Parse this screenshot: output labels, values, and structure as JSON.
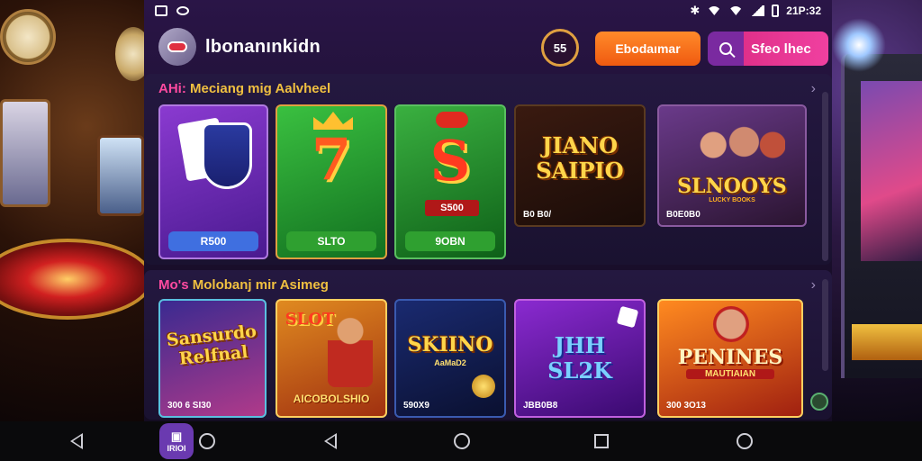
{
  "status_bar": {
    "time": "21P:32"
  },
  "header": {
    "username": "lbonanınkidn",
    "coin_label": "55",
    "deposit_label": "Ebodaımar",
    "search_label": "Sfeo lhec"
  },
  "sections": [
    {
      "title_accent": "AHi:",
      "title": "Meciang mig Aalvheel",
      "cards": [
        {
          "art": "cards",
          "pill": "R500",
          "pill_color": "#3f6fe0"
        },
        {
          "art": "7",
          "pill": "SLTO",
          "pill_color": "#2fa030"
        },
        {
          "art": "S",
          "label": "S500",
          "pill": "9OBN",
          "pill_color": "#2fa030"
        },
        {
          "art_title": "JIANO SAIPIO",
          "meta": "B0 B0/"
        },
        {
          "art_title": "SLNOOYS",
          "subtitle": "LUCKY BOOKS",
          "meta": "B0E0B0"
        }
      ]
    },
    {
      "title_accent": "Mo's",
      "title": "Molobanj mir Asimeg",
      "cards": [
        {
          "art_title": "Sansurdo Relfnal",
          "meta": "300 6 SI30"
        },
        {
          "art_title": "SLOT",
          "subtitle": "AICOBOLSHIO"
        },
        {
          "art_title": "SKIINO",
          "subtitle": "AaMaD2",
          "meta": "590X9"
        },
        {
          "art_title": "JHH SL2K",
          "meta": "JBB0B8"
        },
        {
          "art_title": "PENINES",
          "subtitle": "MAUTIAIAN",
          "meta": "300 3O13"
        }
      ]
    }
  ],
  "nav": {
    "app_label": "IRIOI"
  },
  "colors": {
    "accent": "#f05a10",
    "search": "#e0308a",
    "section_title": "#f0c040"
  }
}
